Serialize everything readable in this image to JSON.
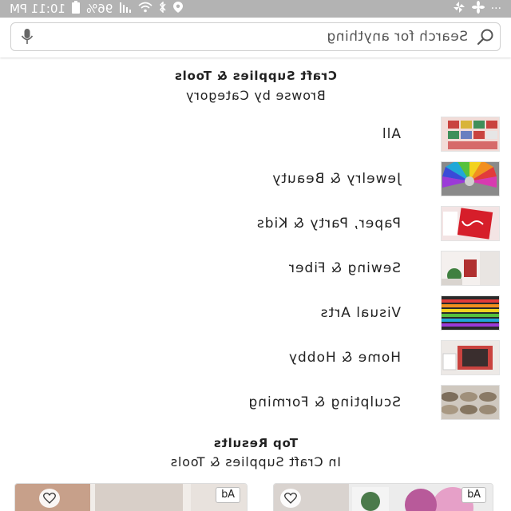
{
  "status_bar": {
    "time": "10:11 PM",
    "battery": "96%",
    "overflow": "···"
  },
  "search": {
    "placeholder": "Search for anything"
  },
  "header": {
    "title": "Craft Supplies & Tools",
    "subtitle": "Browse by Category"
  },
  "categories": [
    {
      "label": "All"
    },
    {
      "label": "Jewelry & Beauty"
    },
    {
      "label": "Paper, Party & Kids"
    },
    {
      "label": "Sewing & Fiber"
    },
    {
      "label": "Visual Arts"
    },
    {
      "label": "Home & Hobby"
    },
    {
      "label": "Sculpting & Forming"
    }
  ],
  "top_results": {
    "title": "Top Results",
    "subtitle": "In Craft Supplies & Tools",
    "cards": [
      {
        "badge": "Ad"
      },
      {
        "badge": "Ad"
      }
    ]
  },
  "colors": {
    "status_bar_bg": "#b3b3b3",
    "search_border": "#cfcfcf"
  }
}
